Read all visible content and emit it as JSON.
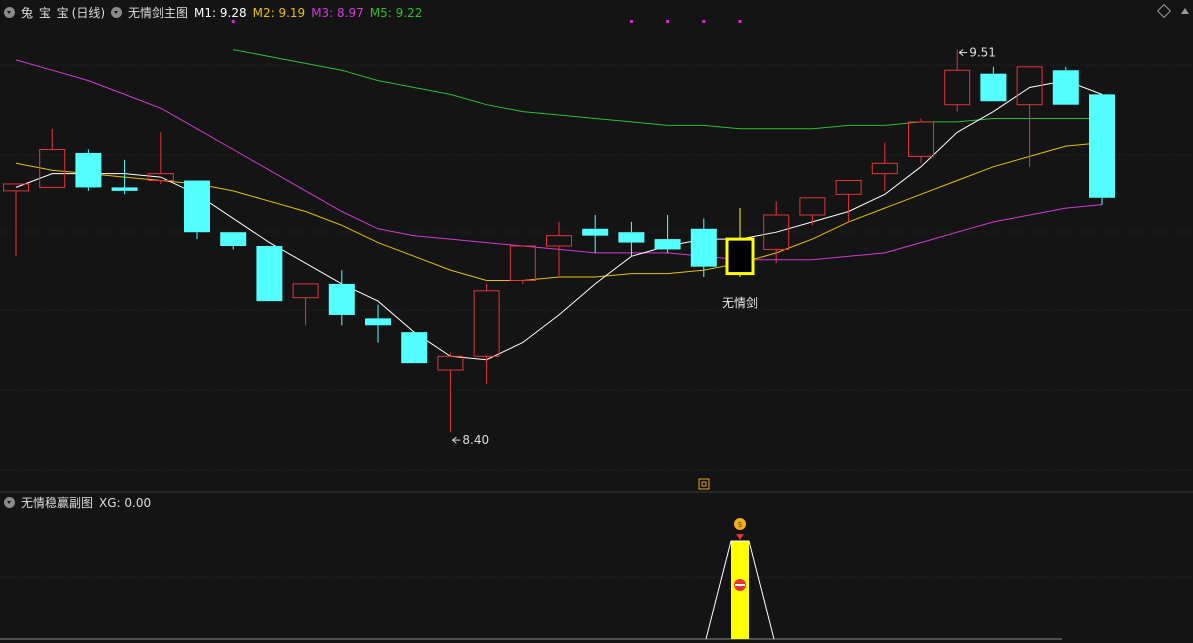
{
  "main_header": {
    "stock_name": "兔 宝 宝",
    "period": "(日线)",
    "indicator_title": "无情剑主图",
    "m1_label": "M1: 9.28",
    "m2_label": "M2: 9.19",
    "m3_label": "M3: 8.97",
    "m5_label": "M5: 9.22"
  },
  "sub_header": {
    "indicator_title": "无情稳赢副图",
    "xg_label": "XG: 0.00"
  },
  "colors": {
    "background": "#141414",
    "up": "#e0353c",
    "down": "#54ffff",
    "signal": "#ffff00",
    "m1": "#ffffff",
    "m2": "#e8c200",
    "m3": "#d13bd6",
    "m5": "#2ec02e",
    "marker": "#e020e0"
  },
  "icons": [
    "collapse-icon",
    "diamond-icon",
    "scroll-up-icon",
    "money-bag-icon",
    "red-ball-icon",
    "period-box-icon"
  ],
  "chart_data": [
    {
      "type": "candlestick",
      "title": "无情剑主图",
      "ylim": [
        8.3,
        9.6
      ],
      "grid": true,
      "candles": [
        {
          "o": 9.11,
          "h": 9.13,
          "l": 8.92,
          "c": 9.13
        },
        {
          "o": 9.12,
          "h": 9.29,
          "l": 9.12,
          "c": 9.23
        },
        {
          "o": 9.22,
          "h": 9.23,
          "l": 9.11,
          "c": 9.12
        },
        {
          "o": 9.12,
          "h": 9.2,
          "l": 9.1,
          "c": 9.11
        },
        {
          "o": 9.14,
          "h": 9.28,
          "l": 9.13,
          "c": 9.16
        },
        {
          "o": 9.14,
          "h": 9.14,
          "l": 8.97,
          "c": 8.99
        },
        {
          "o": 8.99,
          "h": 8.99,
          "l": 8.94,
          "c": 8.95
        },
        {
          "o": 8.95,
          "h": 8.95,
          "l": 8.79,
          "c": 8.79
        },
        {
          "o": 8.8,
          "h": 8.84,
          "l": 8.72,
          "c": 8.84
        },
        {
          "o": 8.84,
          "h": 8.88,
          "l": 8.72,
          "c": 8.75
        },
        {
          "o": 8.74,
          "h": 8.78,
          "l": 8.67,
          "c": 8.72
        },
        {
          "o": 8.7,
          "h": 8.7,
          "l": 8.61,
          "c": 8.61
        },
        {
          "o": 8.59,
          "h": 8.64,
          "l": 8.41,
          "c": 8.63
        },
        {
          "o": 8.63,
          "h": 8.84,
          "l": 8.55,
          "c": 8.82
        },
        {
          "o": 8.85,
          "h": 8.95,
          "l": 8.84,
          "c": 8.95
        },
        {
          "o": 8.95,
          "h": 9.02,
          "l": 8.86,
          "c": 8.98
        },
        {
          "o": 9.0,
          "h": 9.04,
          "l": 8.93,
          "c": 8.98
        },
        {
          "o": 8.99,
          "h": 9.02,
          "l": 8.92,
          "c": 8.96
        },
        {
          "o": 8.97,
          "h": 9.04,
          "l": 8.93,
          "c": 8.94
        },
        {
          "o": 9.0,
          "h": 9.03,
          "l": 8.86,
          "c": 8.89
        },
        {
          "o": 8.97,
          "h": 9.06,
          "l": 8.86,
          "c": 8.87
        },
        {
          "o": 8.94,
          "h": 9.08,
          "l": 8.9,
          "c": 9.04
        },
        {
          "o": 9.04,
          "h": 9.09,
          "l": 9.01,
          "c": 9.09
        },
        {
          "o": 9.1,
          "h": 9.14,
          "l": 9.02,
          "c": 9.14
        },
        {
          "o": 9.16,
          "h": 9.25,
          "l": 9.11,
          "c": 9.19
        },
        {
          "o": 9.21,
          "h": 9.32,
          "l": 9.19,
          "c": 9.31
        },
        {
          "o": 9.36,
          "h": 9.52,
          "l": 9.34,
          "c": 9.46
        },
        {
          "o": 9.45,
          "h": 9.47,
          "l": 9.37,
          "c": 9.37
        },
        {
          "o": 9.36,
          "h": 9.47,
          "l": 9.18,
          "c": 9.47
        },
        {
          "o": 9.46,
          "h": 9.47,
          "l": 9.36,
          "c": 9.36
        },
        {
          "o": 9.39,
          "h": 9.39,
          "l": 9.07,
          "c": 9.09
        }
      ],
      "series": [
        {
          "name": "M1",
          "values": [
            9.12,
            9.16,
            9.16,
            9.16,
            9.15,
            9.1,
            9.03,
            8.96,
            8.9,
            8.84,
            8.79,
            8.7,
            8.63,
            8.62,
            8.67,
            8.75,
            8.84,
            8.92,
            8.95,
            8.97,
            8.97,
            8.99,
            9.02,
            9.05,
            9.1,
            9.18,
            9.28,
            9.34,
            9.41,
            9.43,
            9.39
          ]
        },
        {
          "name": "M2",
          "values": [
            9.19,
            9.17,
            9.16,
            9.15,
            9.14,
            9.13,
            9.11,
            9.08,
            9.05,
            9.01,
            8.96,
            8.92,
            8.88,
            8.85,
            8.85,
            8.86,
            8.86,
            8.87,
            8.87,
            8.88,
            8.9,
            8.93,
            8.97,
            9.02,
            9.06,
            9.1,
            9.14,
            9.18,
            9.21,
            9.24,
            9.25
          ]
        },
        {
          "name": "M3",
          "values": [
            9.49,
            9.46,
            9.43,
            9.39,
            9.35,
            9.29,
            9.23,
            9.17,
            9.11,
            9.05,
            9.0,
            8.98,
            8.97,
            8.96,
            8.95,
            8.94,
            8.93,
            8.93,
            8.93,
            8.92,
            8.91,
            8.91,
            8.91,
            8.92,
            8.93,
            8.96,
            8.99,
            9.02,
            9.04,
            9.06,
            9.07
          ]
        },
        {
          "name": "M5",
          "values": [
            9.61,
            9.6,
            9.59,
            9.58,
            9.57,
            9.55,
            9.52,
            9.5,
            9.48,
            9.46,
            9.43,
            9.41,
            9.39,
            9.36,
            9.34,
            9.33,
            9.32,
            9.31,
            9.3,
            9.3,
            9.29,
            9.29,
            9.29,
            9.3,
            9.3,
            9.31,
            9.31,
            9.32,
            9.32,
            9.32,
            9.32
          ],
          "start": 6
        }
      ],
      "signal_index": 20,
      "signal_label": "无情剑",
      "annotations": [
        {
          "index": 12,
          "value": 8.41,
          "text": "8.40"
        },
        {
          "index": 26,
          "value": 9.52,
          "text": "9.51"
        }
      ],
      "markers": [
        6,
        17,
        18,
        19,
        20
      ]
    },
    {
      "type": "bar",
      "title": "无情稳赢副图",
      "ylim": [
        0,
        1
      ],
      "signal_index": 20,
      "values": [
        0,
        0,
        0,
        0,
        0,
        0,
        0,
        0,
        0,
        0,
        0,
        0,
        0,
        0,
        0,
        0,
        0,
        0,
        0,
        0,
        1,
        0,
        0,
        0,
        0,
        0,
        0,
        0,
        0,
        0,
        0
      ]
    }
  ]
}
